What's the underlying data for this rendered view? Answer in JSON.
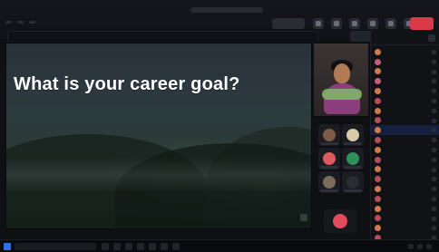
{
  "top_bar": {
    "meeting_timer": "",
    "leave_label": ""
  },
  "banner": {
    "text": "",
    "button_label": ""
  },
  "slide": {
    "caption": "",
    "title": "What is your career goal?",
    "corner_tag": "",
    "presenter_label": ""
  },
  "raised_hand_count": "",
  "participants_panel": {
    "header": "",
    "items": [
      {
        "name": "",
        "color": "#d07a4c"
      },
      {
        "name": "",
        "color": "#c85b7a"
      },
      {
        "name": "",
        "color": "#d07a4c"
      },
      {
        "name": "",
        "color": "#c85b7a"
      },
      {
        "name": "",
        "color": "#d07a4c"
      },
      {
        "name": "",
        "color": "#b84b5a"
      },
      {
        "name": "",
        "color": "#d07a4c"
      },
      {
        "name": "",
        "color": "#b84b5a"
      },
      {
        "name": "",
        "color": "#d07a4c",
        "selected": true
      },
      {
        "name": "",
        "color": "#b84b5a"
      },
      {
        "name": "",
        "color": "#d07a4c"
      },
      {
        "name": "",
        "color": "#b84b5a"
      },
      {
        "name": "",
        "color": "#d07a4c"
      },
      {
        "name": "",
        "color": "#b84b5a"
      },
      {
        "name": "",
        "color": "#d07a4c"
      },
      {
        "name": "",
        "color": "#b84b5a"
      },
      {
        "name": "",
        "color": "#d07a4c"
      },
      {
        "name": "",
        "color": "#b84b5a"
      },
      {
        "name": "",
        "color": "#d07a4c"
      },
      {
        "name": "",
        "color": "#b84b5a"
      }
    ]
  },
  "video_tiles": [
    {
      "initials": "",
      "color": "#7d5a48"
    },
    {
      "initials": "",
      "color": "#d8c9a8"
    },
    {
      "initials": "",
      "color": "#d95b5b"
    },
    {
      "initials": "",
      "color": "#2f8f5b"
    },
    {
      "initials": "",
      "color": "#7a6b5a"
    },
    {
      "initials": "",
      "color": "#2a2c33"
    }
  ],
  "taskbar": {
    "search_placeholder": "",
    "tray_text": ""
  },
  "colors": {
    "accent": "#2f65ff",
    "leave_red": "#d93a4a"
  }
}
